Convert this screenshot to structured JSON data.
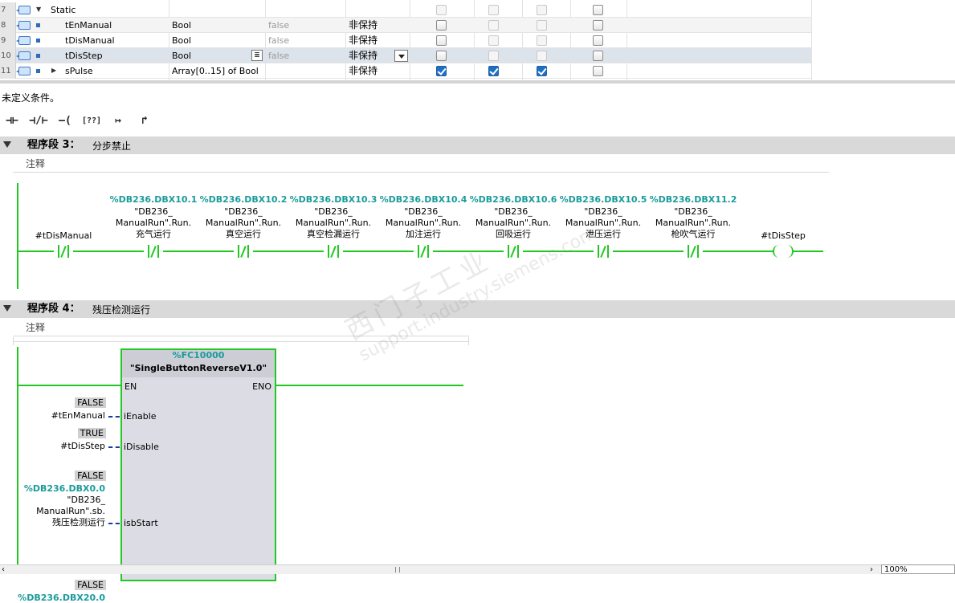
{
  "interface": {
    "rows": [
      {
        "num": "7",
        "name": "Static",
        "type": "",
        "default": "",
        "retain": "",
        "checks": [
          "dim",
          "dim",
          "dim",
          "off"
        ]
      },
      {
        "num": "8",
        "name": "tEnManual",
        "type": "Bool",
        "default": "false",
        "retain": "非保持",
        "checks": [
          "off",
          "dim",
          "dim",
          "off"
        ]
      },
      {
        "num": "9",
        "name": "tDisManual",
        "type": "Bool",
        "default": "false",
        "retain": "非保持",
        "checks": [
          "off",
          "dim",
          "dim",
          "off"
        ]
      },
      {
        "num": "10",
        "name": "tDisStep",
        "type": "Bool",
        "default": "false",
        "retain": "非保持",
        "checks": [
          "off",
          "dim",
          "dim",
          "off"
        ]
      },
      {
        "num": "11",
        "name": "sPulse",
        "type": "Array[0..15] of Bool",
        "default": "",
        "retain": "非保持",
        "checks": [
          "on",
          "on",
          "on",
          "off"
        ]
      }
    ]
  },
  "message": "未定义条件。",
  "toolbar": {
    "buttons": [
      "⊣⊢",
      "⊣/⊢",
      "–( )–",
      "[??]",
      "↦",
      "↱"
    ]
  },
  "network3": {
    "title": "程序段 3：",
    "name": "分步禁止",
    "comment": "注释",
    "contacts": [
      {
        "addr": "",
        "line1": "",
        "line2": "",
        "line3": "#tDisManual"
      },
      {
        "addr": "%DB236.DBX10.1",
        "line1": "\"DB236_",
        "line2": "ManualRun\".Run.",
        "line3": "充气运行"
      },
      {
        "addr": "%DB236.DBX10.2",
        "line1": "\"DB236_",
        "line2": "ManualRun\".Run.",
        "line3": "真空运行"
      },
      {
        "addr": "%DB236.DBX10.3",
        "line1": "\"DB236_",
        "line2": "ManualRun\".Run.",
        "line3": "真空检漏运行"
      },
      {
        "addr": "%DB236.DBX10.4",
        "line1": "\"DB236_",
        "line2": "ManualRun\".Run.",
        "line3": "加注运行"
      },
      {
        "addr": "%DB236.DBX10.6",
        "line1": "\"DB236_",
        "line2": "ManualRun\".Run.",
        "line3": "回吸运行"
      },
      {
        "addr": "%DB236.DBX10.5",
        "line1": "\"DB236_",
        "line2": "ManualRun\".Run.",
        "line3": "泄压运行"
      },
      {
        "addr": "%DB236.DBX11.2",
        "line1": "\"DB236_",
        "line2": "ManualRun\".Run.",
        "line3": "枪吹气运行"
      }
    ],
    "coil": "#tDisStep"
  },
  "network4": {
    "title": "程序段 4：",
    "name": "残压检测运行",
    "comment": "注释",
    "fb_addr": "%FC10000",
    "fb_name": "\"SingleButtonReverseV1.0\"",
    "en": "EN",
    "eno": "ENO",
    "pins": [
      {
        "val": "FALSE",
        "addr": "",
        "l1": "",
        "l2": "",
        "l3": "#tEnManual",
        "pin": "iEnable"
      },
      {
        "val": "TRUE",
        "addr": "",
        "l1": "",
        "l2": "",
        "l3": "#tDisStep",
        "pin": "iDisable"
      },
      {
        "val": "FALSE",
        "addr": "%DB236.DBX0.0",
        "l1": "\"DB236_",
        "l2": "ManualRun\".sb.",
        "l3": "残压检测运行",
        "pin": "isbStart"
      },
      {
        "val": "FALSE",
        "addr": "%DB236.DBX20.0",
        "l1": "",
        "l2": "",
        "l3": "",
        "pin": ""
      }
    ]
  },
  "watermark": {
    "line1": "西门子工业",
    "line2": "support.industry.siemens.com"
  },
  "zoom": "100%"
}
